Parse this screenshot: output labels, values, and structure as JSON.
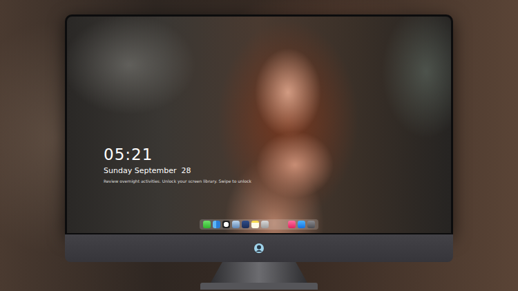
{
  "lock_screen": {
    "time": "05:21",
    "date": "Sunday September  28",
    "hint": "Review overnight activities. Unlock your screen library. Swipe to unlock"
  }
}
